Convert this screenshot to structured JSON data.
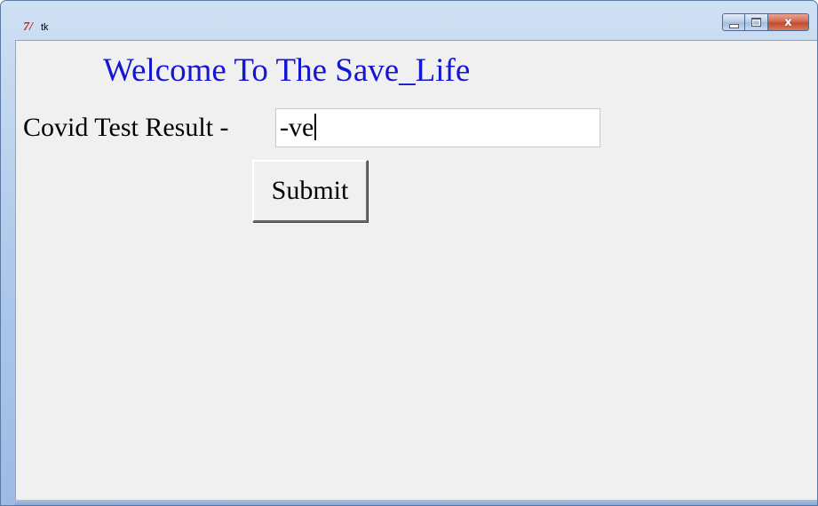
{
  "window": {
    "title": "tk",
    "icon": "tk-feather-icon",
    "caption_buttons": {
      "minimize": "minimize-icon",
      "maximize": "maximize-icon",
      "close_label": "x"
    }
  },
  "main": {
    "welcome_text": "Welcome To The Save_Life",
    "result_label": "Covid Test Result -",
    "result_value": "-ve",
    "submit_label": "Submit"
  },
  "colors": {
    "welcome_text": "#1515d4",
    "client_background": "#f0f0f0"
  }
}
